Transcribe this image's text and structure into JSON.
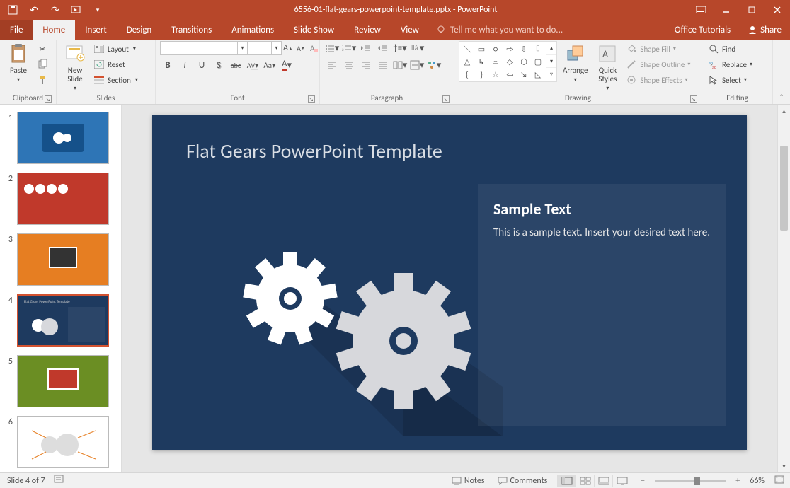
{
  "titlebar": {
    "doc_title": "6556-01-flat-gears-powerpoint-template.pptx - PowerPoint",
    "qat": {
      "save": "save-icon",
      "undo": "undo-icon",
      "redo": "redo-icon",
      "start": "start-from-beginning-icon"
    }
  },
  "tabs": {
    "file": "File",
    "home": "Home",
    "insert": "Insert",
    "design": "Design",
    "transitions": "Transitions",
    "animations": "Animations",
    "slideshow": "Slide Show",
    "review": "Review",
    "view": "View",
    "tellme": "Tell me what you want to do...",
    "office_tutorials": "Office Tutorials",
    "share": "Share"
  },
  "ribbon": {
    "clipboard": {
      "label": "Clipboard",
      "paste": "Paste",
      "cut": "Cut",
      "copy": "Copy",
      "format_painter": "Format Painter"
    },
    "slides": {
      "label": "Slides",
      "new_slide": "New\nSlide",
      "layout": "Layout",
      "reset": "Reset",
      "section": "Section"
    },
    "font": {
      "label": "Font",
      "bold": "B",
      "italic": "I",
      "underline": "U",
      "shadow": "S",
      "strike": "abc",
      "spacing": "AV",
      "case": "Aa",
      "incsize": "A",
      "decsize": "A",
      "clear": "A"
    },
    "paragraph": {
      "label": "Paragraph"
    },
    "drawing": {
      "label": "Drawing",
      "arrange": "Arrange",
      "quick_styles": "Quick\nStyles",
      "shape_fill": "Shape Fill",
      "shape_outline": "Shape Outline",
      "shape_effects": "Shape Effects"
    },
    "editing": {
      "label": "Editing",
      "find": "Find",
      "replace": "Replace",
      "select": "Select"
    }
  },
  "slide": {
    "title": "Flat Gears PowerPoint Template",
    "sample_heading": "Sample Text",
    "sample_body": "This is a sample text. Insert your desired text here."
  },
  "thumbnails": {
    "total": 7,
    "selected": 4,
    "items": [
      1,
      2,
      3,
      4,
      5,
      6
    ]
  },
  "status": {
    "slide_of": "Slide 4 of 7",
    "lang": "",
    "notes": "Notes",
    "comments": "Comments",
    "zoom_pct": "66%"
  },
  "views": {
    "normal": "Normal",
    "sorter": "Slide Sorter",
    "reading": "Reading View",
    "slideshow": "Slide Show"
  }
}
